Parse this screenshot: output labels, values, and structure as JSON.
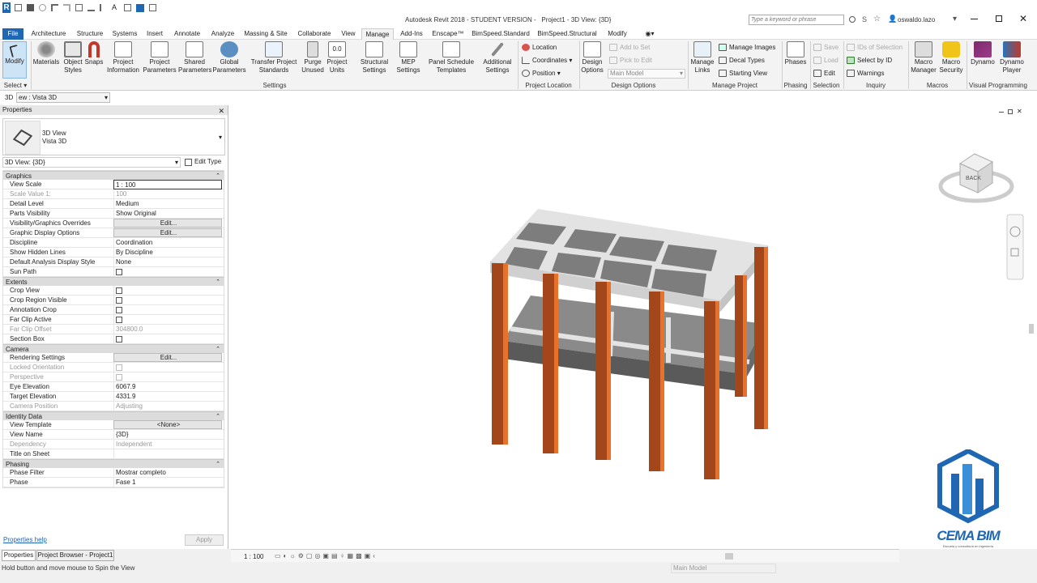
{
  "titlebar": {
    "app_title": "Autodesk Revit 2018 - STUDENT VERSION -",
    "doc_title": "Project1 - 3D View: {3D}",
    "search_placeholder": "Type a keyword or phrase",
    "user": "oswaldo.lazo"
  },
  "menu": {
    "tabs": [
      "File",
      "Architecture",
      "Structure",
      "Systems",
      "Insert",
      "Annotate",
      "Analyze",
      "Massing & Site",
      "Collaborate",
      "View",
      "Manage",
      "Add-Ins",
      "Enscape™",
      "BimSpeed.Standard",
      "BimSpeed.Structural",
      "Modify"
    ],
    "active": "Manage"
  },
  "ribbon": {
    "select": {
      "modify": "Modify",
      "label": "Select"
    },
    "settings": {
      "buttons": [
        "Materials",
        "Object Styles",
        "Snaps",
        "Project Information",
        "Project Parameters",
        "Shared Parameters",
        "Global Parameters",
        "Transfer Project Standards",
        "Purge Unused",
        "Project Units",
        "Structural Settings",
        "MEP Settings",
        "Panel Schedule Templates",
        "Additional Settings"
      ],
      "label": "Settings"
    },
    "project_location": {
      "items": [
        "Location",
        "Coordinates",
        "Position"
      ],
      "label": "Project Location"
    },
    "design_options": {
      "button": "Design Options",
      "items": [
        "Add to Set",
        "Pick to Edit"
      ],
      "dropdown": "Main Model",
      "label": "Design Options"
    },
    "manage_project": {
      "button": "Manage Links",
      "items": [
        "Manage Images",
        "Decal Types",
        "Starting View"
      ],
      "label": "Manage Project"
    },
    "phasing": {
      "button": "Phases",
      "label": "Phasing"
    },
    "selection": {
      "items": [
        "Save",
        "Load",
        "Edit"
      ],
      "label": "Selection"
    },
    "inquiry": {
      "items": [
        "IDs of Selection",
        "Select by ID",
        "Warnings"
      ],
      "label": "Inquiry"
    },
    "macros": {
      "buttons": [
        "Macro Manager",
        "Macro Security"
      ],
      "label": "Macros"
    },
    "visual_programming": {
      "buttons": [
        "Dynamo",
        "Dynamo Player"
      ],
      "label": "Visual Programming"
    }
  },
  "view_selector": {
    "prefix": "3D",
    "value": "ew : Vista 3D"
  },
  "properties": {
    "title": "Properties",
    "type_name": "3D View",
    "type_sub": "Vista 3D",
    "instance_selector": "3D View: {3D}",
    "edit_type": "Edit Type",
    "sections": [
      {
        "name": "Graphics",
        "rows": [
          {
            "k": "View Scale",
            "v": "1 : 100",
            "kind": "input"
          },
          {
            "k": "Scale Value    1:",
            "v": "100",
            "kind": "dis"
          },
          {
            "k": "Detail Level",
            "v": "Medium"
          },
          {
            "k": "Parts Visibility",
            "v": "Show Original"
          },
          {
            "k": "Visibility/Graphics Overrides",
            "v": "Edit...",
            "kind": "btn"
          },
          {
            "k": "Graphic Display Options",
            "v": "Edit...",
            "kind": "btn"
          },
          {
            "k": "Discipline",
            "v": "Coordination"
          },
          {
            "k": "Show Hidden Lines",
            "v": "By Discipline"
          },
          {
            "k": "Default Analysis Display Style",
            "v": "None"
          },
          {
            "k": "Sun Path",
            "v": "",
            "kind": "chk"
          }
        ]
      },
      {
        "name": "Extents",
        "rows": [
          {
            "k": "Crop View",
            "v": "",
            "kind": "chk"
          },
          {
            "k": "Crop Region Visible",
            "v": "",
            "kind": "chk"
          },
          {
            "k": "Annotation Crop",
            "v": "",
            "kind": "chk"
          },
          {
            "k": "Far Clip Active",
            "v": "",
            "kind": "chk"
          },
          {
            "k": "Far Clip Offset",
            "v": "304800.0",
            "kind": "dis"
          },
          {
            "k": "Section Box",
            "v": "",
            "kind": "chk"
          }
        ]
      },
      {
        "name": "Camera",
        "rows": [
          {
            "k": "Rendering Settings",
            "v": "Edit...",
            "kind": "btn"
          },
          {
            "k": "Locked Orientation",
            "v": "",
            "kind": "dischk"
          },
          {
            "k": "Perspective",
            "v": "",
            "kind": "dischk"
          },
          {
            "k": "Eye Elevation",
            "v": "6067.9"
          },
          {
            "k": "Target Elevation",
            "v": "4331.9"
          },
          {
            "k": "Camera Position",
            "v": "Adjusting",
            "kind": "dis"
          }
        ]
      },
      {
        "name": "Identity Data",
        "rows": [
          {
            "k": "View Template",
            "v": "<None>",
            "kind": "btn"
          },
          {
            "k": "View Name",
            "v": "{3D}"
          },
          {
            "k": "Dependency",
            "v": "Independent",
            "kind": "dis"
          },
          {
            "k": "Title on Sheet",
            "v": ""
          }
        ]
      },
      {
        "name": "Phasing",
        "rows": [
          {
            "k": "Phase Filter",
            "v": "Mostrar completo"
          },
          {
            "k": "Phase",
            "v": "Fase 1"
          }
        ]
      }
    ],
    "help": "Properties help",
    "apply": "Apply",
    "tabs": [
      "Properties",
      "Project Browser - Project1"
    ]
  },
  "viewcube": {
    "face": "BACK"
  },
  "canvas": {
    "scale": "1 : 100"
  },
  "status": {
    "hint": "Hold button and move mouse to Spin the View",
    "model": "Main Model"
  },
  "logo": {
    "text": "CEMA BIM",
    "tagline": "Escuela y consultoría en ingeniería"
  },
  "colors": {
    "accent": "#1f66b3",
    "column": "#a3461a",
    "column_light": "#e8722a",
    "slab": "#7d7d7d",
    "beam": "#e3e3e3"
  }
}
